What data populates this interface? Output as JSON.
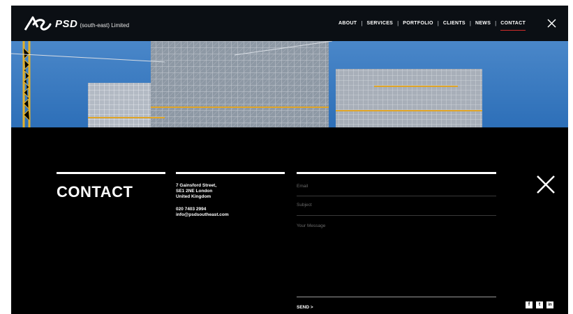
{
  "header": {
    "brand_name": "PSD",
    "brand_suffix": "(south-east) Limited",
    "nav": [
      {
        "label": "ABOUT"
      },
      {
        "label": "SERVICES"
      },
      {
        "label": "PORTFOLIO"
      },
      {
        "label": "CLIENTS"
      },
      {
        "label": "NEWS"
      },
      {
        "label": "CONTACT",
        "active": true
      }
    ],
    "separator": "|",
    "close_icon": "close-icon"
  },
  "hero": {
    "image": "building-under-scaffolding-with-cranes"
  },
  "contact": {
    "title": "CONTACT",
    "address_lines": [
      "7 Gainsford Street,",
      "SE1 2NE London",
      "United Kingdom"
    ],
    "phone": "020 7403 2994",
    "email": "info@psdsoutheast.com",
    "form": {
      "email_placeholder": "Email",
      "subject_placeholder": "Subject",
      "message_placeholder": "Your Message",
      "send_label": "SEND >"
    },
    "close_icon": "close-icon",
    "social": [
      {
        "icon": "facebook-icon",
        "glyph": "f"
      },
      {
        "icon": "twitter-icon",
        "glyph": "t"
      },
      {
        "icon": "linkedin-icon",
        "glyph": "in"
      }
    ]
  },
  "colors": {
    "header_bg": "#0b0f14",
    "panel_bg": "#000000",
    "accent": "#d12b2b",
    "sky": "#2d6fb8",
    "scaffold": "#c9ced6"
  }
}
